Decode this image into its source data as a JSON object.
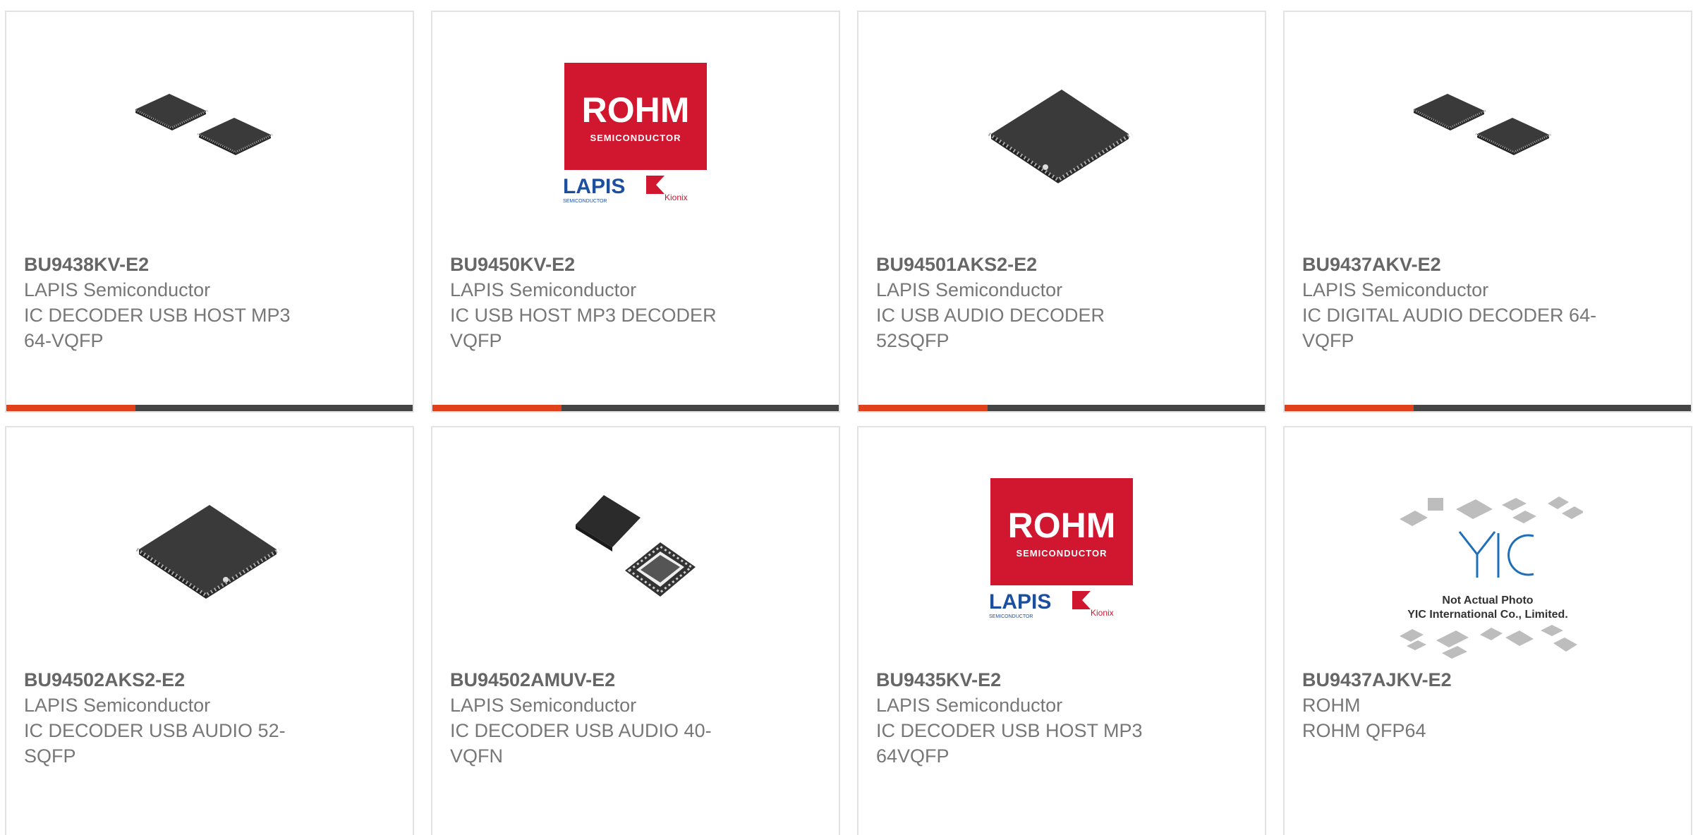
{
  "colors": {
    "accent": "#e0401a",
    "bar_dark": "#444444",
    "rohm_red": "#d0172f",
    "lapis_blue": "#1d4f9f"
  },
  "products": [
    {
      "part": "BU9438KV-E2",
      "maker": "LAPIS Semiconductor",
      "desc": "IC DECODER USB HOST MP3 64-VQFP",
      "image": "two-qfp-chips"
    },
    {
      "part": "BU9450KV-E2",
      "maker": "LAPIS Semiconductor",
      "desc": "IC USB HOST MP3 DECODER VQFP",
      "image": "rohm-lapis-logo"
    },
    {
      "part": "BU94501AKS2-E2",
      "maker": "LAPIS Semiconductor",
      "desc": "IC USB AUDIO DECODER 52SQFP",
      "image": "single-qfp-chip"
    },
    {
      "part": "BU9437AKV-E2",
      "maker": "LAPIS Semiconductor",
      "desc": "IC DIGITAL AUDIO DECODER 64-VQFP",
      "image": "two-qfp-chips"
    },
    {
      "part": "BU94502AKS2-E2",
      "maker": "LAPIS Semiconductor",
      "desc": "IC DECODER USB AUDIO 52-SQFP",
      "image": "single-qfp-chip"
    },
    {
      "part": "BU94502AMUV-E2",
      "maker": "LAPIS Semiconductor",
      "desc": "IC DECODER USB AUDIO 40-VQFN",
      "image": "qfn-chips"
    },
    {
      "part": "BU9435KV-E2",
      "maker": "LAPIS Semiconductor",
      "desc": "IC DECODER USB HOST MP3 64VQFP",
      "image": "rohm-lapis-logo"
    },
    {
      "part": "BU9437AJKV-E2",
      "maker": "ROHM",
      "desc": "ROHM QFP64",
      "image": "yic-placeholder"
    }
  ],
  "logos": {
    "rohm": "ROHM",
    "semiconductor": "SEMICONDUCTOR",
    "lapis": "LAPIS",
    "lapis_sub": "SEMICONDUCTOR",
    "kionix": "Kionix"
  },
  "placeholder": {
    "brand": "YIC",
    "line1": "Not Actual Photo",
    "line2": "YIC International Co., Limited."
  }
}
